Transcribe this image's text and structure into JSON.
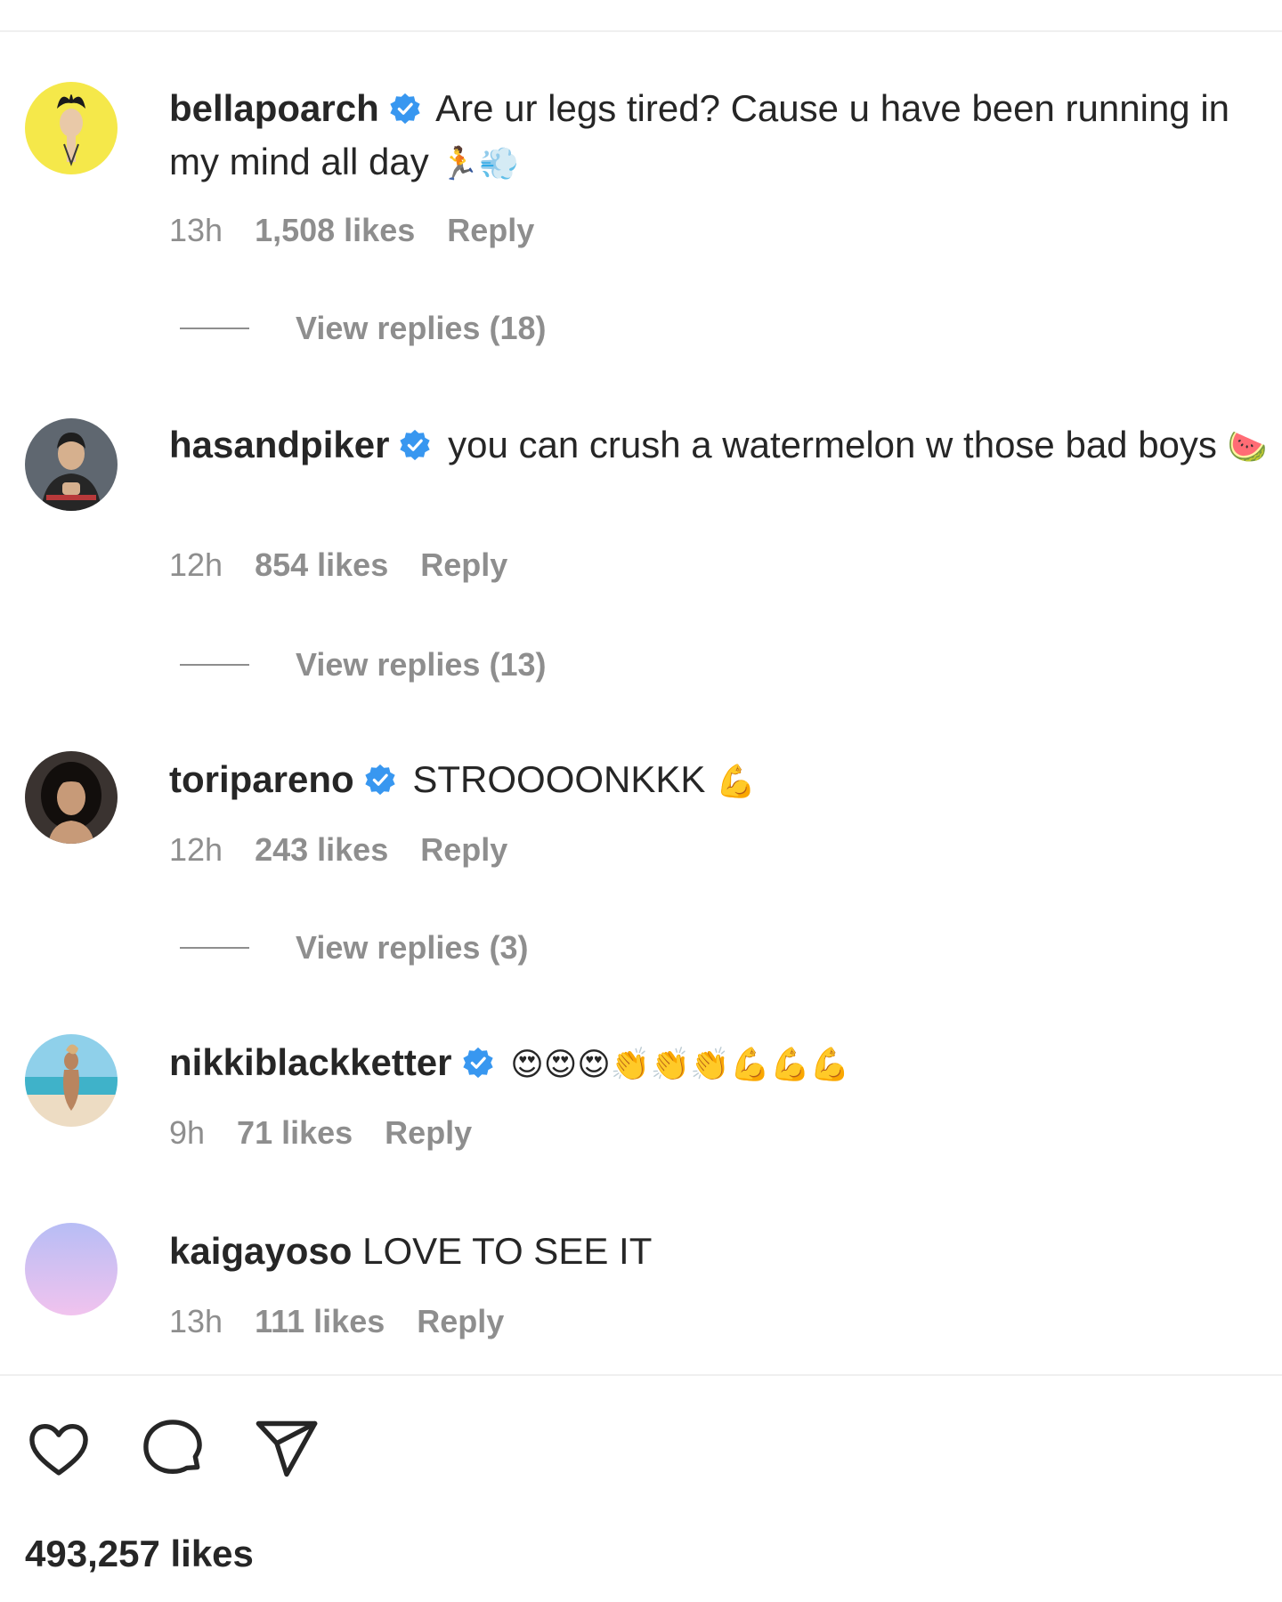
{
  "comments": [
    {
      "username": "bellapoarch",
      "verified": true,
      "text": "Are ur legs tired? Cause u have been running in my mind all day",
      "emoji": "🏃💨",
      "time": "13h",
      "likes": "1,508 likes",
      "reply_label": "Reply",
      "view_replies": "View replies (18)"
    },
    {
      "username": "hasandpiker",
      "verified": true,
      "text": "you can crush a watermelon w those bad boys",
      "emoji": "🍉",
      "time": "12h",
      "likes": "854 likes",
      "reply_label": "Reply",
      "view_replies": "View replies (13)"
    },
    {
      "username": "toripareno",
      "verified": true,
      "text": "STROOOONKKK",
      "emoji": "💪",
      "time": "12h",
      "likes": "243 likes",
      "reply_label": "Reply",
      "view_replies": "View replies (3)"
    },
    {
      "username": "nikkiblackketter",
      "verified": true,
      "text": "",
      "emoji": "😍😍😍👏👏👏💪💪💪",
      "time": "9h",
      "likes": "71 likes",
      "reply_label": "Reply"
    },
    {
      "username": "kaigayoso",
      "verified": false,
      "text": "LOVE TO SEE IT",
      "emoji": "",
      "time": "13h",
      "likes": "111 likes",
      "reply_label": "Reply"
    }
  ],
  "actions": {
    "like_icon": "heart-icon",
    "comment_icon": "comment-bubble-icon",
    "share_icon": "paper-plane-icon"
  },
  "post": {
    "total_likes": "493,257 likes"
  },
  "colors": {
    "verified_blue": "#3897f0",
    "meta_gray": "#8e8e8e",
    "text": "#262626"
  }
}
